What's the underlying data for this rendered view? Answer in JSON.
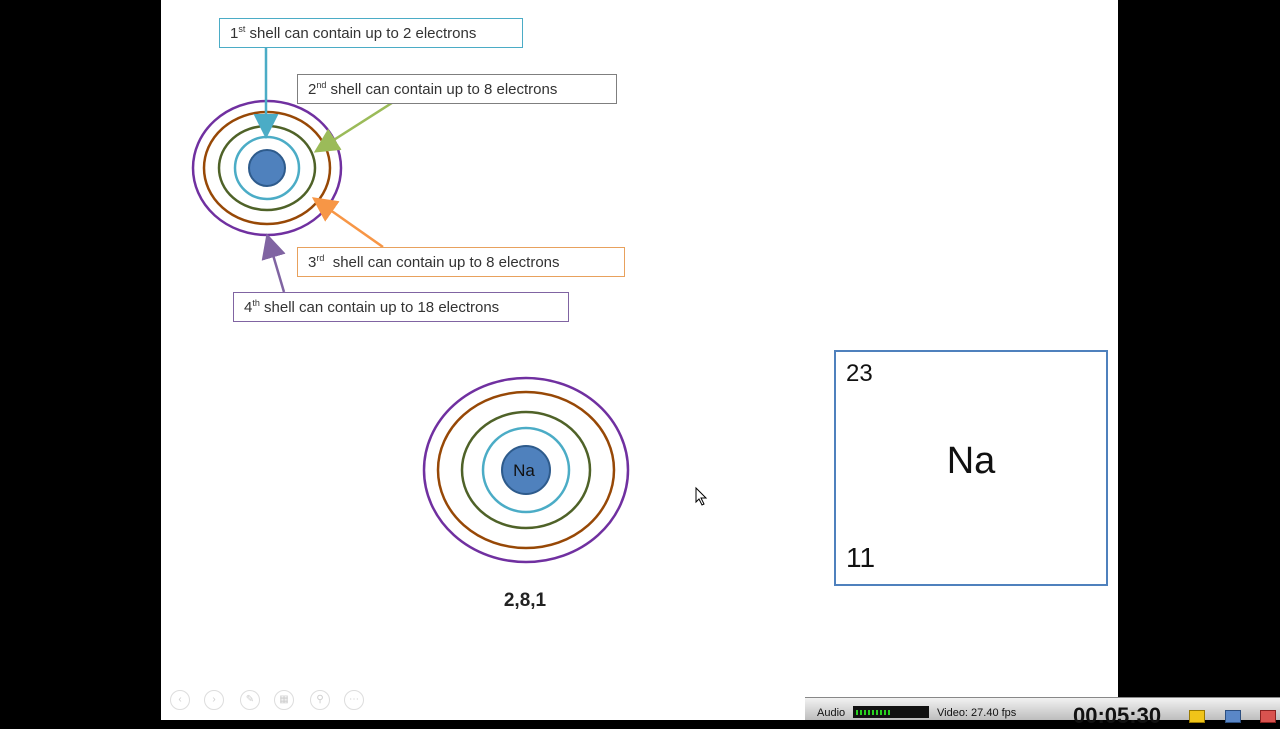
{
  "slide": {
    "labels": {
      "shell1": {
        "prefix": "1",
        "sup": "st",
        "text": " shell can contain up to 2 electrons"
      },
      "shell2": {
        "prefix": "2",
        "sup": "nd",
        "text": " shell can contain up to 8 electrons"
      },
      "shell3": {
        "prefix": "3",
        "sup": "rd",
        "text": "  shell can contain up to 8 electrons"
      },
      "shell4": {
        "prefix": "4",
        "sup": "th",
        "text": " shell can contain up to 18 electrons"
      }
    },
    "atom_nucleus_label": "Na",
    "electron_configuration": "2,8,1",
    "element_card": {
      "mass_number": "23",
      "symbol": "Na",
      "atomic_number": "11"
    },
    "shell_colors": {
      "shell1": "#4bacc6",
      "shell2": "#4f6228",
      "shell3": "#974806",
      "shell4": "#7030a0",
      "nucleus": "#4f81bd"
    }
  },
  "recorder": {
    "audio_label": "Audio",
    "video_label": "Video: 27.40 fps",
    "time": "00:05:30"
  }
}
